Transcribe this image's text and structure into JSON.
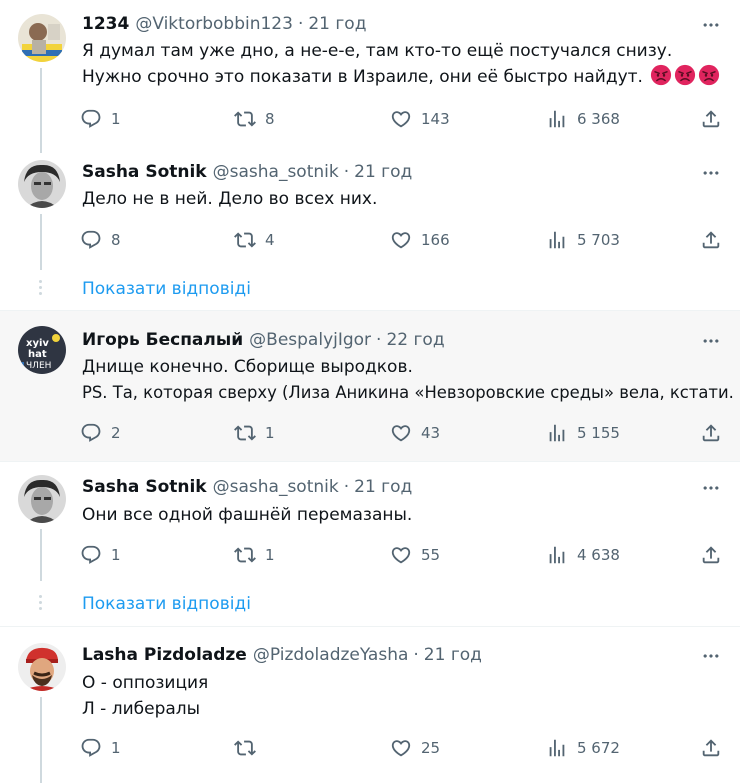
{
  "tweets": [
    {
      "name": "1234",
      "handle": "@Viktorbobbin123",
      "dot": "·",
      "time": "21 год",
      "lines": [
        "Я думал там уже дно, а не-е-е, там кто-то ещё постучался снизу.",
        "Нужно срочно это показати в Израиле, они её быстро найдут."
      ],
      "emojis": [
        "angry-face-emoji",
        "angry-face-emoji",
        "angry-face-emoji"
      ],
      "replies": "1",
      "retweets": "8",
      "likes": "143",
      "views": "6 368"
    },
    {
      "name": "Sasha Sotnik",
      "handle": "@sasha_sotnik",
      "dot": "·",
      "time": "21 год",
      "lines": [
        "Дело не в ней. Дело во всех них."
      ],
      "replies": "8",
      "retweets": "4",
      "likes": "166",
      "views": "5 703"
    },
    {
      "name": "Игорь Беспалый",
      "handle": "@BespalyjIgor",
      "dot": "·",
      "time": "22 год",
      "lines": [
        "Днище конечно. Сборище выродков.",
        "PS. Та, которая сверху (Лиза Аникина «Невзоровские среды» вела, кстати."
      ],
      "replies": "2",
      "retweets": "1",
      "likes": "43",
      "views": "5 155"
    },
    {
      "name": "Sasha Sotnik",
      "handle": "@sasha_sotnik",
      "dot": "·",
      "time": "21 год",
      "lines": [
        "Они все одной фашнёй перемазаны."
      ],
      "replies": "1",
      "retweets": "1",
      "likes": "55",
      "views": "4 638"
    },
    {
      "name": "Lasha Pizdoladze",
      "handle": "@PizdoladzeYasha",
      "dot": "·",
      "time": "21 год",
      "lines": [
        "О - оппозиция",
        "Л - либералы"
      ],
      "replies": "1",
      "retweets": "",
      "likes": "25",
      "views": "5 672"
    }
  ],
  "show_replies_label": "Показати відповіді",
  "colors": {
    "text": "#0f1419",
    "secondary": "#536471",
    "link": "#1d9bf0",
    "thread_line": "#cfd9de",
    "highlight_bg": "#f7f7f7",
    "divider": "#eff3f4"
  },
  "icons": [
    "more-icon",
    "reply-icon",
    "retweet-icon",
    "like-icon",
    "views-icon",
    "share-icon"
  ]
}
